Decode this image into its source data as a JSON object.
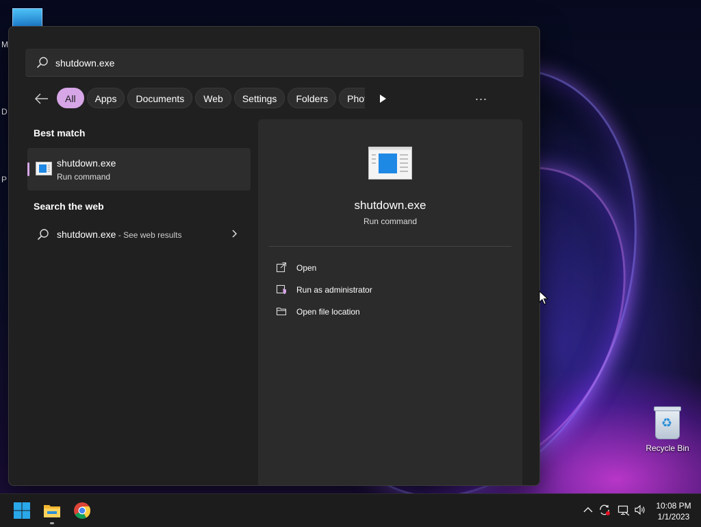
{
  "desktop": {
    "side_letters": [
      "M",
      "D",
      "P"
    ],
    "recycle_bin_label": "Recycle Bin"
  },
  "search": {
    "query": "shutdown.exe"
  },
  "filters": {
    "chips": [
      {
        "label": "All",
        "active": true
      },
      {
        "label": "Apps",
        "active": false
      },
      {
        "label": "Documents",
        "active": false
      },
      {
        "label": "Web",
        "active": false
      },
      {
        "label": "Settings",
        "active": false
      },
      {
        "label": "Folders",
        "active": false
      },
      {
        "label": "Photos",
        "active": false
      }
    ],
    "more_label": "..."
  },
  "results": {
    "best_match_heading": "Best match",
    "best_match": {
      "name": "shutdown.exe",
      "subtitle": "Run command"
    },
    "web_heading": "Search the web",
    "web_item": {
      "query": "shutdown.exe",
      "suffix": " - See web results"
    }
  },
  "preview": {
    "title": "shutdown.exe",
    "subtitle": "Run command",
    "actions": [
      {
        "label": "Open",
        "icon": "open-external-icon"
      },
      {
        "label": "Run as administrator",
        "icon": "shield-admin-icon"
      },
      {
        "label": "Open file location",
        "icon": "folder-icon"
      }
    ]
  },
  "taskbar": {
    "apps": [
      "start-icon",
      "file-explorer-icon",
      "chrome-icon"
    ],
    "tray": [
      "chevron-up-icon",
      "sync-icon",
      "network-icon",
      "volume-icon"
    ],
    "time": "10:08 PM",
    "date": "1/1/2023"
  },
  "colors": {
    "accent": "#d6a6e6",
    "panel": "#202020",
    "preview": "#2b2b2b"
  }
}
